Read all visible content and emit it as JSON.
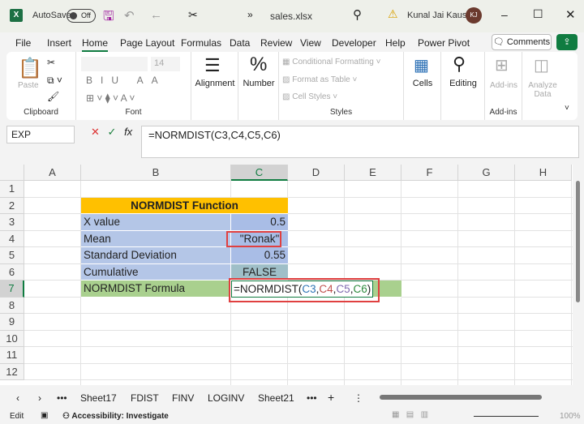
{
  "titlebar": {
    "autosave": "AutoSave",
    "autosave_state": "Off",
    "filename": "sales.xlsx",
    "user": "Kunal Jai Kaushik",
    "initials": "KJ"
  },
  "menu": {
    "tabs": [
      "File",
      "Insert",
      "Home",
      "Page Layout",
      "Formulas",
      "Data",
      "Review",
      "View",
      "Developer",
      "Help",
      "Power Pivot"
    ],
    "active": "Home",
    "comments": "Comments"
  },
  "ribbon": {
    "paste": "Paste",
    "clipboard": "Clipboard",
    "font_size": "14",
    "font": "Font",
    "alignment": "Alignment",
    "number": "Number",
    "conditional_formatting": "Conditional Formatting",
    "format_as_table": "Format as Table",
    "cell_styles": "Cell Styles",
    "styles": "Styles",
    "cells": "Cells",
    "editing": "Editing",
    "addins": "Add-ins",
    "addins_group": "Add-ins",
    "analyze_data": "Analyze Data"
  },
  "formula_bar": {
    "name_box": "EXP",
    "fx": "fx",
    "formula": "=NORMDIST(C3,C4,C5,C6)"
  },
  "columns": [
    "A",
    "B",
    "C",
    "D",
    "E",
    "F",
    "G",
    "H"
  ],
  "rows": [
    "1",
    "2",
    "3",
    "4",
    "5",
    "6",
    "7",
    "8",
    "9",
    "10",
    "11",
    "12"
  ],
  "table": {
    "header": "NORMDIST Function",
    "labels": [
      "X value",
      "Mean",
      "Standard Deviation",
      "Cumulative",
      "NORMDIST Formula"
    ],
    "values": [
      "0.5",
      "\"Ronak\"",
      "0.55",
      "FALSE"
    ],
    "formula_parts": [
      "=NORMDIST(",
      "C3",
      ",",
      "C4",
      ",",
      "C5",
      ",",
      "C6",
      ")"
    ]
  },
  "colors": {
    "header": "#ffc000",
    "label_fill": "#b4c6e7",
    "formula_row": "#a9d08e",
    "accent": "#107c41",
    "highlight_box": "#e04040"
  },
  "sheets": {
    "tabs": [
      "Sheet17",
      "FDIST",
      "FINV",
      "LOGINV",
      "Sheet21"
    ]
  },
  "status": {
    "mode": "Edit",
    "accessibility": "Accessibility: Investigate",
    "zoom": "100%"
  }
}
